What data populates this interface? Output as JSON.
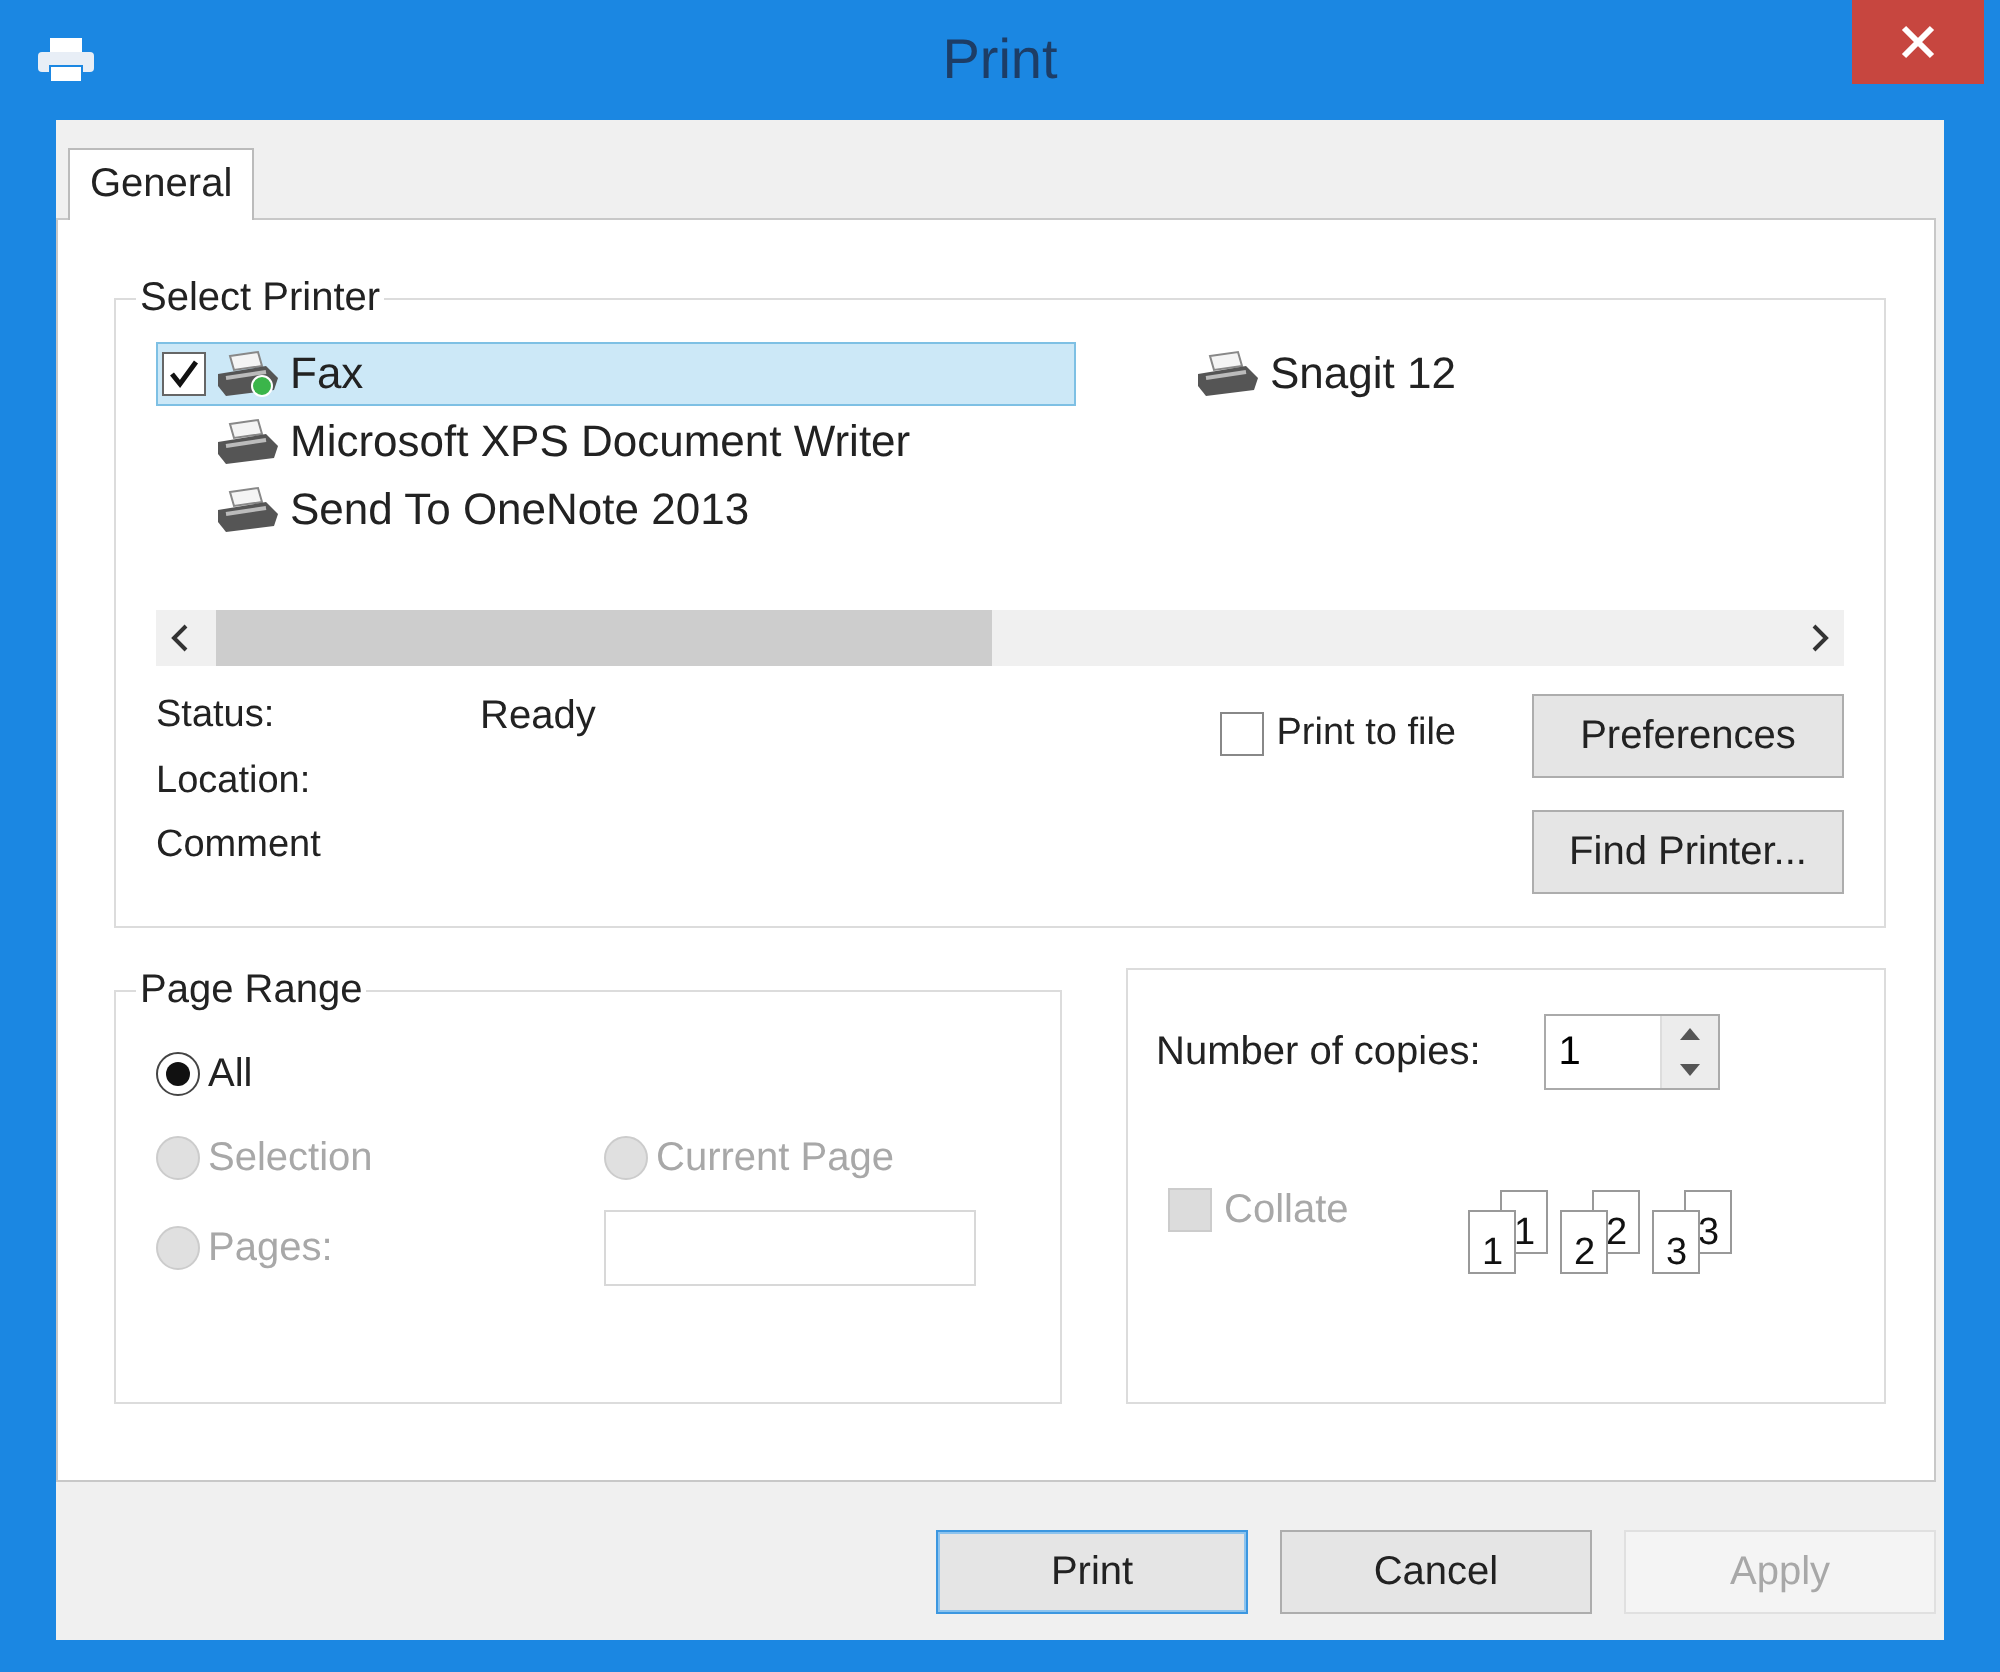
{
  "window": {
    "title": "Print"
  },
  "tabs": [
    {
      "label": "General",
      "selected": true
    }
  ],
  "select_printer": {
    "legend": "Select Printer",
    "printers": [
      {
        "name": "Fax",
        "selected": true,
        "default": true,
        "kind": "fax"
      },
      {
        "name": "Microsoft XPS Document Writer",
        "selected": false,
        "default": false,
        "kind": "printer"
      },
      {
        "name": "Send To OneNote 2013",
        "selected": false,
        "default": false,
        "kind": "printer"
      },
      {
        "name": "Snagit 12",
        "selected": false,
        "default": false,
        "kind": "printer"
      }
    ],
    "info": [
      {
        "label": "Status:",
        "value": "Ready"
      },
      {
        "label": "Location:"
      },
      {
        "label": "Comment"
      }
    ],
    "print_to_file": {
      "label": "Print to file",
      "checked": false
    },
    "buttons": [
      {
        "label": "Preferences",
        "disabled": false
      },
      {
        "label": "Find Printer...",
        "disabled": false
      }
    ]
  },
  "page_range": {
    "legend": "Page Range",
    "options": [
      {
        "label": "All",
        "selected": true,
        "disabled": false
      },
      {
        "label": "Selection",
        "selected": false,
        "disabled": true
      },
      {
        "label": "Current Page",
        "selected": false,
        "disabled": true
      },
      {
        "label": "Pages:",
        "selected": false,
        "disabled": true
      }
    ],
    "pages_field": {
      "disabled": true
    }
  },
  "copies": {
    "label": "Number of copies:",
    "value": "1",
    "collate": {
      "label": "Collate",
      "checked": false,
      "disabled": true
    },
    "collate_labels": [
      "1",
      "1",
      "2",
      "2",
      "3",
      "3"
    ]
  },
  "footer_buttons": [
    {
      "label": "Print",
      "default": true,
      "disabled": false
    },
    {
      "label": "Cancel",
      "default": false,
      "disabled": false
    },
    {
      "label": "Apply",
      "default": false,
      "disabled": true
    }
  ]
}
